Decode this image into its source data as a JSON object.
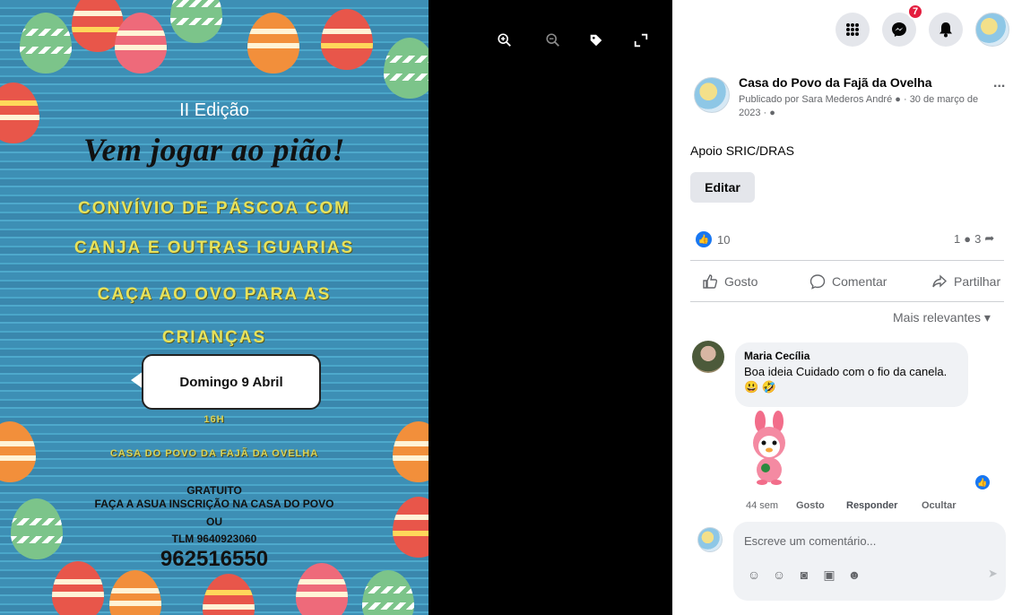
{
  "poster": {
    "edition": "II Edição",
    "headline": "Vem jogar ao pião!",
    "line1": "CONVÍVIO DE PÁSCOA COM",
    "line2": "CANJA E OUTRAS IGUARIAS",
    "line3": "CAÇA AO OVO PARA AS",
    "line4": "CRIANÇAS",
    "date": "Domingo 9 Abril",
    "time": "16H",
    "venue": "CASA DO POVO DA FAJÃ DA OVELHA",
    "free": "GRATUITO",
    "signup": "FAÇA A ASUA INSCRIÇÃO NA CASA DO POVO",
    "or": "OU",
    "tlm": "TLM 9640923060",
    "phone": "962516550"
  },
  "nav": {
    "messenger_badge": "7"
  },
  "post": {
    "page_name": "Casa do Povo da Fajã da Ovelha",
    "meta": "Publicado por Sara Mederos André ● · 30 de março de 2023 · ●",
    "more": "...",
    "caption": "Apoio SRIC/DRAS",
    "edit_label": "Editar",
    "like_count": "10",
    "comment_count": "1",
    "share_count": "3",
    "actions": {
      "like": "Gosto",
      "comment": "Comentar",
      "share": "Partilhar"
    },
    "sort_label": "Mais relevantes ▾"
  },
  "comment": {
    "author": "Maria Cecília",
    "text": "Boa ideia Cuidado com o fio da canela. 😃 🤣",
    "time": "44 sem",
    "like": "Gosto",
    "reply": "Responder",
    "hide": "Ocultar"
  },
  "composer": {
    "placeholder": "Escreve um comentário..."
  }
}
